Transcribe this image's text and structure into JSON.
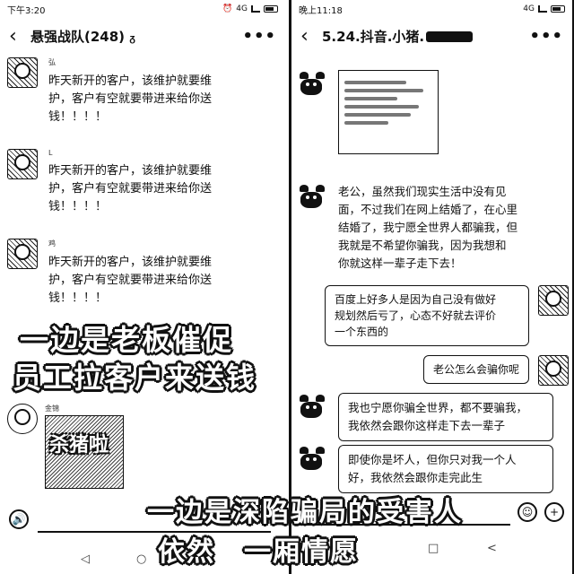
{
  "left_phone": {
    "status": {
      "time": "下午3:20",
      "network": "4G",
      "battery": ""
    },
    "nav": {
      "back": "‹",
      "title": "悬强战队(248)",
      "title_mark": "ᵹ",
      "more": "•••"
    },
    "messages": [
      {
        "sender": "弘",
        "text_lines": [
          "昨天新开的客户，该维护就要维",
          "护，客户有空就要带进来给你送",
          "钱！！！！"
        ]
      },
      {
        "sender": "L",
        "text_lines": [
          "昨天新开的客户，该维护就要维",
          "护，客户有空就要带进来给你送",
          "钱！！！！"
        ]
      },
      {
        "sender": "鸡",
        "text_lines": [
          "昨天新开的客户，该维护就要维",
          "护，客户有空就要带进来给你送",
          "钱！！！！"
        ]
      }
    ],
    "sticker": {
      "sender": "金锦",
      "label": "杀猪啦"
    },
    "bottom": {
      "voice_icon": "🔊",
      "nav_back": "◁",
      "nav_home": "○"
    }
  },
  "right_phone": {
    "status": {
      "time": "晚上11:18",
      "network": "4G",
      "battery": ""
    },
    "nav": {
      "back": "‹",
      "title": "5.24.抖音.小猪.",
      "more": "•••"
    },
    "messages": [
      {
        "from": "pig",
        "text_lines": [
          "老公，虽然我们现实生活中没有见",
          "面，不过我们在网上结婚了，在心里",
          "结婚了，我宁愿全世界人都骗我，但",
          "我就是不希望你骗我，因为我想和",
          "你就这样一辈子走下去！"
        ]
      },
      {
        "from": "self",
        "text_lines": [
          "百度上好多人是因为自己没有做好",
          "规划然后亏了，心态不好就去评价",
          "一个东西的"
        ]
      },
      {
        "from": "self",
        "text_lines": [
          "老公怎么会骗你呢"
        ]
      },
      {
        "from": "pig",
        "text_lines": [
          "我也宁愿你骗全世界，都不要骗我，",
          "我依然会跟你这样走下去一辈子"
        ]
      },
      {
        "from": "pig",
        "text_lines": [
          "即使你是坏人，但你只对我一个人",
          "好，我依然会跟你走完此生"
        ]
      }
    ],
    "bottom": {
      "emoji_icon": "☺",
      "plus_icon": "+",
      "nav_home": "□",
      "nav_back": "<"
    }
  },
  "captions": {
    "left_line1": "一边是老板催促",
    "left_line2": "员工拉客户来送钱",
    "right_line1": "一边是深陷骗局的受害人",
    "right_line2": "依然　一厢情愿"
  }
}
